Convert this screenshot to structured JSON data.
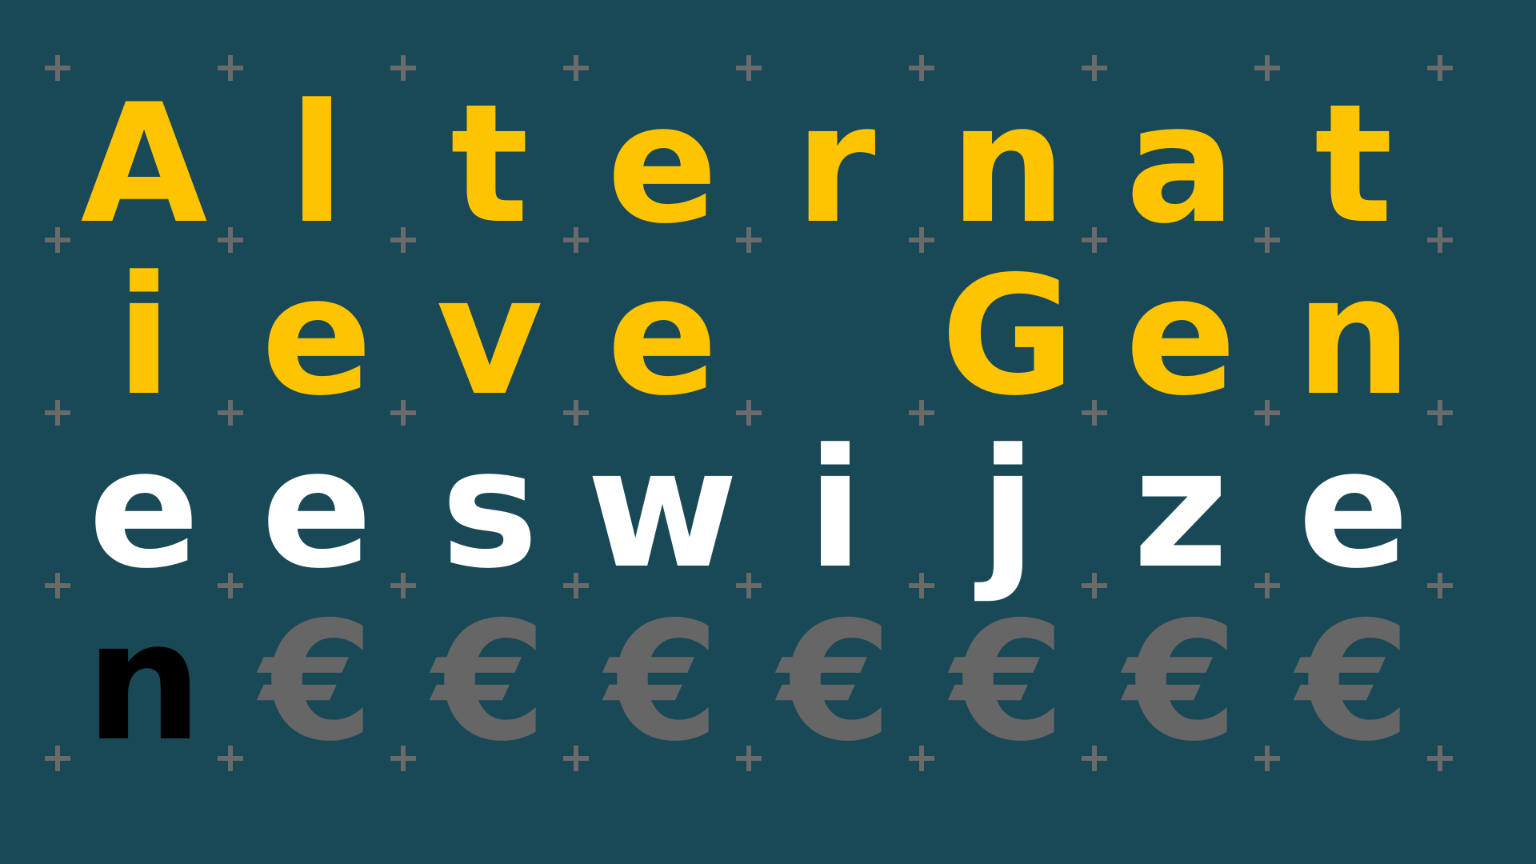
{
  "colors": {
    "background": "#194856",
    "plus": "#6a6a6a",
    "yellow": "#ffc400",
    "white": "#ffffff",
    "black": "#000000",
    "gray": "#666666"
  },
  "grid": {
    "rows": [
      [
        {
          "char": "A",
          "color": "yellow"
        },
        {
          "char": "l",
          "color": "yellow"
        },
        {
          "char": "t",
          "color": "yellow"
        },
        {
          "char": "e",
          "color": "yellow"
        },
        {
          "char": "r",
          "color": "yellow"
        },
        {
          "char": "n",
          "color": "yellow"
        },
        {
          "char": "a",
          "color": "yellow"
        },
        {
          "char": "t",
          "color": "yellow"
        }
      ],
      [
        {
          "char": "i",
          "color": "yellow"
        },
        {
          "char": "e",
          "color": "yellow"
        },
        {
          "char": "v",
          "color": "yellow"
        },
        {
          "char": "e",
          "color": "yellow"
        },
        {
          "char": "",
          "color": "yellow"
        },
        {
          "char": "G",
          "color": "yellow"
        },
        {
          "char": "e",
          "color": "yellow"
        },
        {
          "char": "n",
          "color": "yellow"
        }
      ],
      [
        {
          "char": "e",
          "color": "white"
        },
        {
          "char": "e",
          "color": "white"
        },
        {
          "char": "s",
          "color": "white"
        },
        {
          "char": "w",
          "color": "white"
        },
        {
          "char": "i",
          "color": "white"
        },
        {
          "char": "j",
          "color": "white"
        },
        {
          "char": "z",
          "color": "white"
        },
        {
          "char": "e",
          "color": "white"
        }
      ],
      [
        {
          "char": "n",
          "color": "black"
        },
        {
          "char": "€",
          "color": "gray"
        },
        {
          "char": "€",
          "color": "gray"
        },
        {
          "char": "€",
          "color": "gray"
        },
        {
          "char": "€",
          "color": "gray"
        },
        {
          "char": "€",
          "color": "gray"
        },
        {
          "char": "€",
          "color": "gray"
        },
        {
          "char": "€",
          "color": "gray"
        }
      ]
    ]
  },
  "decorations": {
    "plus_icon": "plus-icon"
  }
}
